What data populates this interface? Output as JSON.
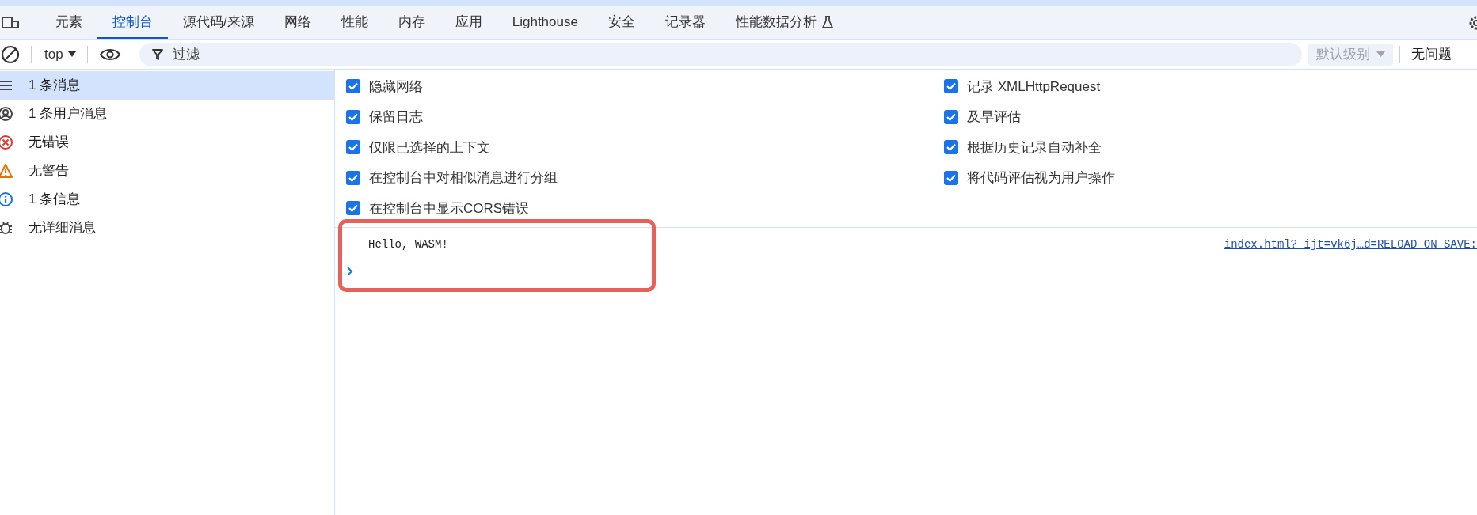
{
  "tabs": [
    {
      "label": "元素",
      "selected": false,
      "kind": "standard"
    },
    {
      "label": "控制台",
      "selected": true,
      "kind": "standard"
    },
    {
      "label": "源代码/来源",
      "selected": false,
      "kind": "standard"
    },
    {
      "label": "网络",
      "selected": false,
      "kind": "standard"
    },
    {
      "label": "性能",
      "selected": false,
      "kind": "standard"
    },
    {
      "label": "内存",
      "selected": false,
      "kind": "standard"
    },
    {
      "label": "应用",
      "selected": false,
      "kind": "standard"
    },
    {
      "label": "Lighthouse",
      "selected": false,
      "kind": "standard"
    },
    {
      "label": "安全",
      "selected": false,
      "kind": "standard"
    },
    {
      "label": "记录器",
      "selected": false,
      "kind": "standard"
    },
    {
      "label": "性能数据分析",
      "selected": false,
      "kind": "experimental"
    }
  ],
  "toolbar": {
    "context": "top",
    "filter": {
      "placeholder": "过滤"
    },
    "level_button": {
      "label": "默认级别",
      "disabled": true
    },
    "issues": "无问题"
  },
  "sidebar": {
    "items": [
      {
        "label": "1 条消息",
        "kind": "all",
        "selected": true
      },
      {
        "label": "1 条用户消息",
        "kind": "user",
        "selected": false
      },
      {
        "label": "无错误",
        "kind": "error",
        "selected": false
      },
      {
        "label": "无警告",
        "kind": "warning",
        "selected": false
      },
      {
        "label": "1 条信息",
        "kind": "info",
        "selected": false
      },
      {
        "label": "无详细消息",
        "kind": "verbose",
        "selected": false
      }
    ]
  },
  "settings": {
    "left": [
      {
        "label": "隐藏网络",
        "checked": true
      },
      {
        "label": "保留日志",
        "checked": true
      },
      {
        "label": "仅限已选择的上下文",
        "checked": true
      },
      {
        "label": "在控制台中对相似消息进行分组",
        "checked": true
      },
      {
        "label": "在控制台中显示CORS错误",
        "checked": true
      }
    ],
    "right": [
      {
        "label": "记录 XMLHttpRequest",
        "checked": true
      },
      {
        "label": "及早评估",
        "checked": true
      },
      {
        "label": "根据历史记录自动补全",
        "checked": true
      },
      {
        "label": "将代码评估视为用户操作",
        "checked": true
      }
    ]
  },
  "console": {
    "messages": [
      {
        "text": "Hello, WASM!",
        "source": "index.html?_ijt=vk6j…d=RELOAD_ON_SAVE:"
      }
    ]
  }
}
